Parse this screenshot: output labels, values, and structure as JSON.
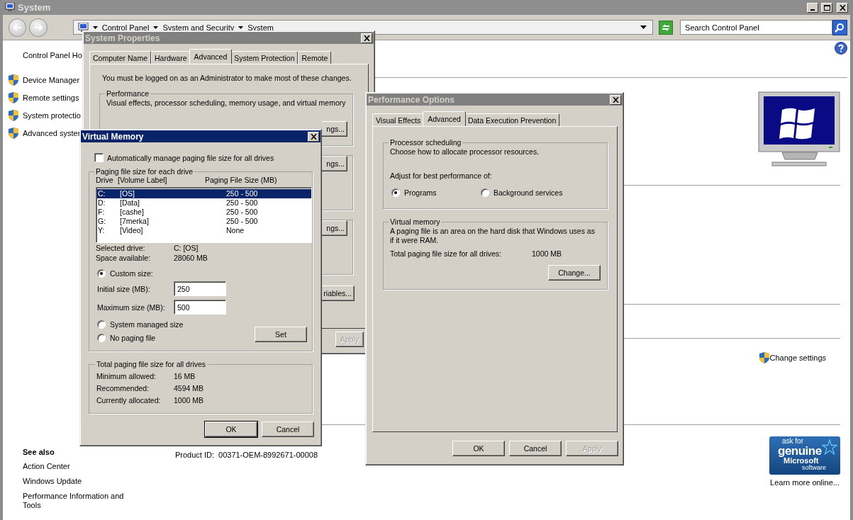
{
  "system_window": {
    "title": "System",
    "active": false,
    "breadcrumbs": [
      "Control Panel",
      "System and Security",
      "System"
    ],
    "search": {
      "placeholder": "Search Control Panel"
    }
  },
  "left_pane": {
    "home_link": "Control Panel Ho",
    "tasks": [
      "Device Manager",
      "Remote settings",
      "System protectio",
      "Advanced syster"
    ],
    "see_also": {
      "heading": "See also",
      "links": [
        "Action Center",
        "Windows Update",
        "Performance Information and Tools"
      ]
    }
  },
  "content": {
    "change_settings": "Change settings",
    "product_id": {
      "label": "Product ID:",
      "value": "00371-OEM-8992671-00008"
    },
    "genuine_badge": [
      "ask for",
      "genuine",
      "Microsoft",
      "software"
    ],
    "learn_more": "Learn more online..."
  },
  "system_properties": {
    "title": "System Properties",
    "active": false,
    "tabs": [
      {
        "label": "Computer Name",
        "selected": false
      },
      {
        "label": "Hardware",
        "selected": false
      },
      {
        "label": "Advanced",
        "selected": true
      },
      {
        "label": "System Protection",
        "selected": false
      },
      {
        "label": "Remote",
        "selected": false
      }
    ],
    "notice": "You must be logged on as an Administrator to make most of these changes.",
    "performance": {
      "legend": "Performance",
      "description": "Visual effects, processor scheduling, memory usage, and virtual memory",
      "button": "ngs..."
    },
    "group_buttons": [
      "ngs...",
      "ngs..."
    ],
    "variables_button": "riables...",
    "apply": {
      "label": "Apply",
      "disabled": true
    }
  },
  "performance_options": {
    "title": "Performance Options",
    "active": false,
    "tabs": [
      {
        "label": "Visual Effects",
        "selected": false
      },
      {
        "label": "Advanced",
        "selected": true
      },
      {
        "label": "Data Execution Prevention",
        "selected": false
      }
    ],
    "scheduling": {
      "legend": "Processor scheduling",
      "description": "Choose how to allocate processor resources.",
      "prompt": "Adjust for best performance of:",
      "options": [
        {
          "label": "Programs",
          "selected": true
        },
        {
          "label": "Background services",
          "selected": false
        }
      ]
    },
    "virtual_memory": {
      "legend": "Virtual memory",
      "description": "A paging file is an area on the hard disk that Windows uses as if it were RAM.",
      "total_label": "Total paging file size for all drives:",
      "total_value": "1000 MB",
      "button": "Change..."
    },
    "buttons": [
      {
        "label": "OK",
        "disabled": false
      },
      {
        "label": "Cancel",
        "disabled": false
      },
      {
        "label": "Apply",
        "disabled": true
      }
    ]
  },
  "virtual_memory": {
    "title": "Virtual Memory",
    "active": true,
    "auto_manage": {
      "label": "Automatically manage paging file size for all drives",
      "checked": false
    },
    "legend": "Paging file size for each drive",
    "columns": [
      "Drive",
      "[Volume Label]",
      "Paging File Size (MB)"
    ],
    "rows": [
      {
        "drive": "C:",
        "label": "[OS]",
        "size": "250 - 500",
        "selected": true
      },
      {
        "drive": "D:",
        "label": "[Data]",
        "size": "250 - 500",
        "selected": false
      },
      {
        "drive": "F:",
        "label": "[cashe]",
        "size": "250 - 500",
        "selected": false
      },
      {
        "drive": "G:",
        "label": "[7merka]",
        "size": "250 - 500",
        "selected": false
      },
      {
        "drive": "Y:",
        "label": "[Video]",
        "size": "None",
        "selected": false
      }
    ],
    "info": [
      {
        "label": "Selected drive:",
        "value": "C:  [OS]"
      },
      {
        "label": "Space available:",
        "value": "28060 MB"
      }
    ],
    "options": [
      {
        "label": "Custom size:",
        "selected": true
      },
      {
        "label": "System managed size",
        "selected": false
      },
      {
        "label": "No paging file",
        "selected": false
      }
    ],
    "fields": [
      {
        "label": "Initial size (MB):",
        "value": "250"
      },
      {
        "label": "Maximum size (MB):",
        "value": "500"
      }
    ],
    "set_button": "Set",
    "totals": {
      "legend": "Total paging file size for all drives",
      "rows": [
        {
          "label": "Minimum allowed:",
          "value": "16 MB"
        },
        {
          "label": "Recommended:",
          "value": "4594 MB"
        },
        {
          "label": "Currently allocated:",
          "value": "1000 MB"
        }
      ]
    },
    "buttons": [
      "OK",
      "Cancel"
    ]
  }
}
